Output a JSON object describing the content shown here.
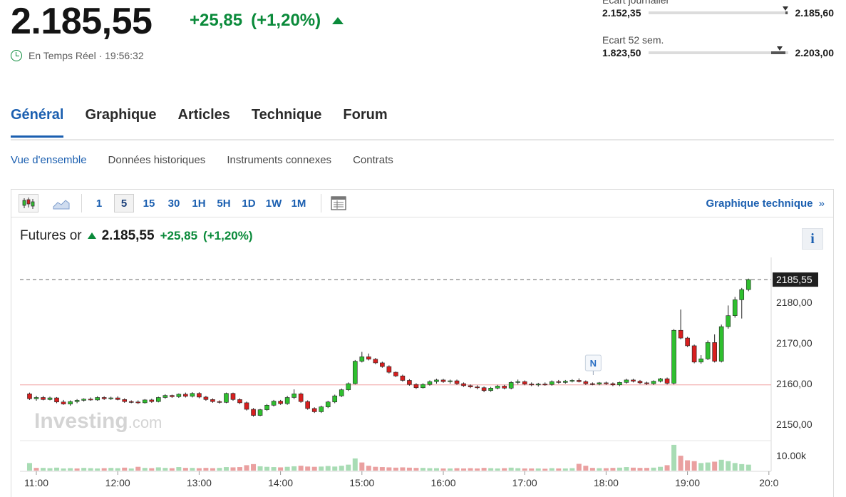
{
  "quote": {
    "price": "2.185,55",
    "change": "+25,85",
    "change_pct": "(+1,20%)",
    "realtime_label": "En Temps Réel · 19:56:32"
  },
  "daily_range": {
    "label": "Écart journalier",
    "low": "2.152,35",
    "high": "2.185,60"
  },
  "range_52w": {
    "label": "Ecart 52 sem.",
    "low": "1.823,50",
    "high": "2.203,00"
  },
  "tabs": [
    {
      "label": "Général",
      "active": true
    },
    {
      "label": "Graphique",
      "active": false
    },
    {
      "label": "Articles",
      "active": false
    },
    {
      "label": "Technique",
      "active": false
    },
    {
      "label": "Forum",
      "active": false
    }
  ],
  "subtabs": [
    {
      "label": "Vue d'ensemble",
      "active": true
    },
    {
      "label": "Données historiques",
      "active": false
    },
    {
      "label": "Instruments connexes",
      "active": false
    },
    {
      "label": "Contrats",
      "active": false
    }
  ],
  "toolbar": {
    "timeframes": [
      "1",
      "5",
      "15",
      "30",
      "1H",
      "5H",
      "1D",
      "1W",
      "1M"
    ],
    "selected_timeframe": "5",
    "technical_link": "Graphique technique",
    "technical_chevron": "»"
  },
  "chart_header": {
    "name": "Futures or",
    "price": "2.185,55",
    "change": "+25,85",
    "change_pct": "(+1,20%)",
    "info_label": "i"
  },
  "chart_data": {
    "type": "candlestick",
    "x_ticks": [
      "11:00",
      "12:00",
      "13:00",
      "14:00",
      "15:00",
      "16:00",
      "17:00",
      "18:00",
      "19:00",
      "20:0"
    ],
    "y_ticks": [
      "2180,00",
      "2170,00",
      "2160,00",
      "2150,00"
    ],
    "y_tick_values": [
      2180,
      2170,
      2160,
      2150
    ],
    "ylim": [
      2146,
      2191
    ],
    "last_price": 2185.55,
    "last_price_label": "2185,55",
    "reference_line": 2159.7,
    "volume_label": "10.00k",
    "news_marker": {
      "label": "N",
      "x_time": "17:50"
    },
    "watermark": {
      "brand": "Investing",
      "suffix": ".com"
    },
    "candle_interval_minutes": 5,
    "start_time": "10:55",
    "colors": {
      "up": "#2fbf2f",
      "down": "#d81f1f",
      "vol_up": "#a8dcb4",
      "vol_down": "#eaa0a0",
      "ref_line": "#f0a0a0"
    },
    "ohlc": [
      [
        2157.5,
        2157.8,
        2156.0,
        2156.3
      ],
      [
        2156.3,
        2157.0,
        2155.8,
        2156.6
      ],
      [
        2156.6,
        2157.0,
        2155.9,
        2156.1
      ],
      [
        2156.1,
        2156.8,
        2155.9,
        2156.5
      ],
      [
        2156.5,
        2156.7,
        2155.2,
        2155.5
      ],
      [
        2155.5,
        2156.0,
        2154.8,
        2155.0
      ],
      [
        2155.0,
        2155.9,
        2154.6,
        2155.6
      ],
      [
        2155.6,
        2156.2,
        2155.2,
        2155.9
      ],
      [
        2155.9,
        2156.4,
        2155.6,
        2156.2
      ],
      [
        2156.2,
        2156.6,
        2155.8,
        2156.0
      ],
      [
        2156.0,
        2156.9,
        2155.8,
        2156.6
      ],
      [
        2156.6,
        2156.9,
        2156.0,
        2156.3
      ],
      [
        2156.3,
        2156.8,
        2156.0,
        2156.5
      ],
      [
        2156.5,
        2156.9,
        2155.9,
        2156.1
      ],
      [
        2156.1,
        2156.4,
        2155.3,
        2155.6
      ],
      [
        2155.6,
        2155.9,
        2155.2,
        2155.5
      ],
      [
        2155.5,
        2155.9,
        2155.0,
        2155.3
      ],
      [
        2155.3,
        2156.2,
        2155.1,
        2156.0
      ],
      [
        2156.0,
        2156.3,
        2155.3,
        2155.6
      ],
      [
        2155.6,
        2156.8,
        2155.4,
        2156.6
      ],
      [
        2156.6,
        2157.4,
        2156.3,
        2157.1
      ],
      [
        2157.1,
        2157.3,
        2156.5,
        2156.8
      ],
      [
        2156.8,
        2157.6,
        2156.5,
        2157.4
      ],
      [
        2157.4,
        2157.8,
        2156.6,
        2156.9
      ],
      [
        2156.9,
        2157.9,
        2156.6,
        2157.6
      ],
      [
        2157.6,
        2157.9,
        2156.4,
        2156.7
      ],
      [
        2156.7,
        2157.0,
        2155.8,
        2156.1
      ],
      [
        2156.1,
        2156.4,
        2155.3,
        2155.6
      ],
      [
        2155.6,
        2155.9,
        2155.1,
        2155.4
      ],
      [
        2155.4,
        2157.8,
        2155.2,
        2157.6
      ],
      [
        2157.6,
        2157.8,
        2155.8,
        2156.1
      ],
      [
        2156.1,
        2156.4,
        2155.0,
        2155.3
      ],
      [
        2155.3,
        2155.6,
        2153.4,
        2153.7
      ],
      [
        2153.7,
        2154.0,
        2151.9,
        2152.2
      ],
      [
        2152.2,
        2153.8,
        2152.0,
        2153.6
      ],
      [
        2153.6,
        2155.0,
        2153.3,
        2154.7
      ],
      [
        2154.7,
        2156.0,
        2154.4,
        2155.7
      ],
      [
        2155.7,
        2156.0,
        2154.8,
        2155.1
      ],
      [
        2155.1,
        2157.0,
        2154.8,
        2156.6
      ],
      [
        2156.6,
        2158.6,
        2156.2,
        2157.5
      ],
      [
        2157.5,
        2157.8,
        2155.3,
        2155.6
      ],
      [
        2155.6,
        2155.9,
        2153.6,
        2153.9
      ],
      [
        2153.9,
        2154.2,
        2152.8,
        2153.1
      ],
      [
        2153.1,
        2154.6,
        2152.8,
        2154.3
      ],
      [
        2154.3,
        2155.8,
        2154.0,
        2155.5
      ],
      [
        2155.5,
        2157.3,
        2155.2,
        2157.0
      ],
      [
        2157.0,
        2158.8,
        2156.7,
        2158.5
      ],
      [
        2158.5,
        2160.3,
        2158.2,
        2160.0
      ],
      [
        2160.0,
        2165.8,
        2159.8,
        2165.5
      ],
      [
        2165.5,
        2167.8,
        2165.2,
        2166.6
      ],
      [
        2166.6,
        2167.4,
        2165.7,
        2166.0
      ],
      [
        2166.0,
        2166.3,
        2164.8,
        2165.1
      ],
      [
        2165.1,
        2165.4,
        2163.9,
        2164.2
      ],
      [
        2164.2,
        2164.5,
        2162.5,
        2162.8
      ],
      [
        2162.8,
        2163.0,
        2161.6,
        2161.9
      ],
      [
        2161.9,
        2162.2,
        2160.5,
        2160.8
      ],
      [
        2160.8,
        2161.1,
        2159.5,
        2159.8
      ],
      [
        2159.8,
        2160.1,
        2158.7,
        2159.0
      ],
      [
        2159.0,
        2160.1,
        2158.8,
        2159.8
      ],
      [
        2159.8,
        2160.8,
        2159.5,
        2160.5
      ],
      [
        2160.5,
        2161.2,
        2160.0,
        2160.9
      ],
      [
        2160.9,
        2161.2,
        2160.2,
        2160.5
      ],
      [
        2160.5,
        2161.0,
        2160.0,
        2160.7
      ],
      [
        2160.7,
        2161.0,
        2159.7,
        2160.0
      ],
      [
        2160.0,
        2160.3,
        2159.2,
        2159.5
      ],
      [
        2159.5,
        2159.8,
        2158.9,
        2159.2
      ],
      [
        2159.2,
        2159.6,
        2158.6,
        2159.0
      ],
      [
        2159.0,
        2159.3,
        2157.9,
        2158.3
      ],
      [
        2158.3,
        2159.2,
        2158.0,
        2158.9
      ],
      [
        2158.9,
        2159.7,
        2158.6,
        2159.4
      ],
      [
        2159.4,
        2159.7,
        2158.6,
        2158.9
      ],
      [
        2158.9,
        2160.6,
        2158.6,
        2160.3
      ],
      [
        2160.3,
        2161.0,
        2159.8,
        2160.5
      ],
      [
        2160.5,
        2160.8,
        2159.6,
        2159.9
      ],
      [
        2159.9,
        2160.3,
        2159.4,
        2159.7
      ],
      [
        2159.7,
        2160.2,
        2159.3,
        2159.9
      ],
      [
        2159.9,
        2160.3,
        2159.5,
        2159.8
      ],
      [
        2159.8,
        2160.8,
        2159.5,
        2160.5
      ],
      [
        2160.5,
        2160.9,
        2160.0,
        2160.3
      ],
      [
        2160.3,
        2160.9,
        2160.0,
        2160.6
      ],
      [
        2160.6,
        2161.1,
        2160.3,
        2160.8
      ],
      [
        2160.8,
        2161.3,
        2160.3,
        2160.5
      ],
      [
        2160.5,
        2160.8,
        2159.7,
        2160.0
      ],
      [
        2160.0,
        2160.3,
        2159.6,
        2159.9
      ],
      [
        2159.9,
        2160.4,
        2159.6,
        2160.2
      ],
      [
        2160.2,
        2160.5,
        2159.7,
        2160.0
      ],
      [
        2160.0,
        2160.3,
        2159.4,
        2159.7
      ],
      [
        2159.7,
        2160.5,
        2159.4,
        2160.3
      ],
      [
        2160.3,
        2161.2,
        2160.0,
        2160.9
      ],
      [
        2160.9,
        2161.2,
        2160.3,
        2160.6
      ],
      [
        2160.6,
        2160.9,
        2159.9,
        2160.2
      ],
      [
        2160.2,
        2160.5,
        2159.7,
        2160.0
      ],
      [
        2160.0,
        2160.8,
        2159.7,
        2160.6
      ],
      [
        2160.6,
        2161.4,
        2160.3,
        2161.2
      ],
      [
        2161.2,
        2161.5,
        2159.8,
        2160.1
      ],
      [
        2160.1,
        2173.4,
        2159.8,
        2173.1
      ],
      [
        2173.1,
        2178.2,
        2170.9,
        2171.2
      ],
      [
        2171.2,
        2171.5,
        2169.0,
        2169.3
      ],
      [
        2169.3,
        2169.6,
        2165.0,
        2165.3
      ],
      [
        2165.3,
        2167.0,
        2164.9,
        2166.1
      ],
      [
        2166.1,
        2170.6,
        2165.8,
        2170.1
      ],
      [
        2170.1,
        2172.1,
        2165.2,
        2165.5
      ],
      [
        2165.5,
        2174.5,
        2165.2,
        2174.0
      ],
      [
        2174.0,
        2179.2,
        2173.5,
        2176.7
      ],
      [
        2176.7,
        2181.3,
        2176.2,
        2180.6
      ],
      [
        2180.6,
        2183.5,
        2176.0,
        2183.1
      ],
      [
        2183.1,
        2185.8,
        2182.7,
        2185.55
      ]
    ],
    "volume": [
      [
        1,
        0.28
      ],
      [
        0,
        0.1
      ],
      [
        1,
        0.1
      ],
      [
        1,
        0.09
      ],
      [
        1,
        0.11
      ],
      [
        1,
        0.08
      ],
      [
        1,
        0.09
      ],
      [
        0,
        0.08
      ],
      [
        1,
        0.1
      ],
      [
        1,
        0.09
      ],
      [
        1,
        0.08
      ],
      [
        0,
        0.09
      ],
      [
        1,
        0.1
      ],
      [
        1,
        0.09
      ],
      [
        0,
        0.11
      ],
      [
        1,
        0.08
      ],
      [
        0,
        0.14
      ],
      [
        1,
        0.1
      ],
      [
        0,
        0.09
      ],
      [
        1,
        0.12
      ],
      [
        1,
        0.1
      ],
      [
        0,
        0.09
      ],
      [
        1,
        0.13
      ],
      [
        0,
        0.1
      ],
      [
        1,
        0.1
      ],
      [
        0,
        0.09
      ],
      [
        0,
        0.1
      ],
      [
        0,
        0.09
      ],
      [
        1,
        0.1
      ],
      [
        1,
        0.13
      ],
      [
        0,
        0.12
      ],
      [
        0,
        0.13
      ],
      [
        0,
        0.2
      ],
      [
        0,
        0.24
      ],
      [
        1,
        0.16
      ],
      [
        1,
        0.14
      ],
      [
        1,
        0.13
      ],
      [
        0,
        0.12
      ],
      [
        1,
        0.14
      ],
      [
        1,
        0.16
      ],
      [
        0,
        0.18
      ],
      [
        0,
        0.15
      ],
      [
        0,
        0.14
      ],
      [
        1,
        0.15
      ],
      [
        1,
        0.17
      ],
      [
        1,
        0.15
      ],
      [
        1,
        0.18
      ],
      [
        1,
        0.22
      ],
      [
        1,
        0.45
      ],
      [
        0,
        0.3
      ],
      [
        0,
        0.18
      ],
      [
        0,
        0.14
      ],
      [
        0,
        0.13
      ],
      [
        0,
        0.12
      ],
      [
        0,
        0.11
      ],
      [
        0,
        0.12
      ],
      [
        0,
        0.11
      ],
      [
        0,
        0.1
      ],
      [
        1,
        0.1
      ],
      [
        1,
        0.09
      ],
      [
        1,
        0.09
      ],
      [
        0,
        0.08
      ],
      [
        1,
        0.08
      ],
      [
        0,
        0.09
      ],
      [
        0,
        0.08
      ],
      [
        0,
        0.09
      ],
      [
        0,
        0.08
      ],
      [
        0,
        0.1
      ],
      [
        1,
        0.09
      ],
      [
        1,
        0.08
      ],
      [
        0,
        0.09
      ],
      [
        1,
        0.11
      ],
      [
        1,
        0.09
      ],
      [
        0,
        0.08
      ],
      [
        0,
        0.08
      ],
      [
        1,
        0.08
      ],
      [
        0,
        0.07
      ],
      [
        1,
        0.09
      ],
      [
        0,
        0.08
      ],
      [
        1,
        0.08
      ],
      [
        1,
        0.09
      ],
      [
        0,
        0.25
      ],
      [
        0,
        0.18
      ],
      [
        0,
        0.1
      ],
      [
        1,
        0.09
      ],
      [
        0,
        0.09
      ],
      [
        0,
        0.1
      ],
      [
        1,
        0.11
      ],
      [
        1,
        0.13
      ],
      [
        0,
        0.11
      ],
      [
        0,
        0.1
      ],
      [
        0,
        0.1
      ],
      [
        1,
        0.11
      ],
      [
        1,
        0.14
      ],
      [
        0,
        0.2
      ],
      [
        1,
        0.95
      ],
      [
        0,
        0.55
      ],
      [
        0,
        0.38
      ],
      [
        0,
        0.35
      ],
      [
        1,
        0.28
      ],
      [
        1,
        0.3
      ],
      [
        0,
        0.33
      ],
      [
        1,
        0.4
      ],
      [
        1,
        0.35
      ],
      [
        1,
        0.28
      ],
      [
        1,
        0.24
      ],
      [
        1,
        0.22
      ]
    ]
  }
}
